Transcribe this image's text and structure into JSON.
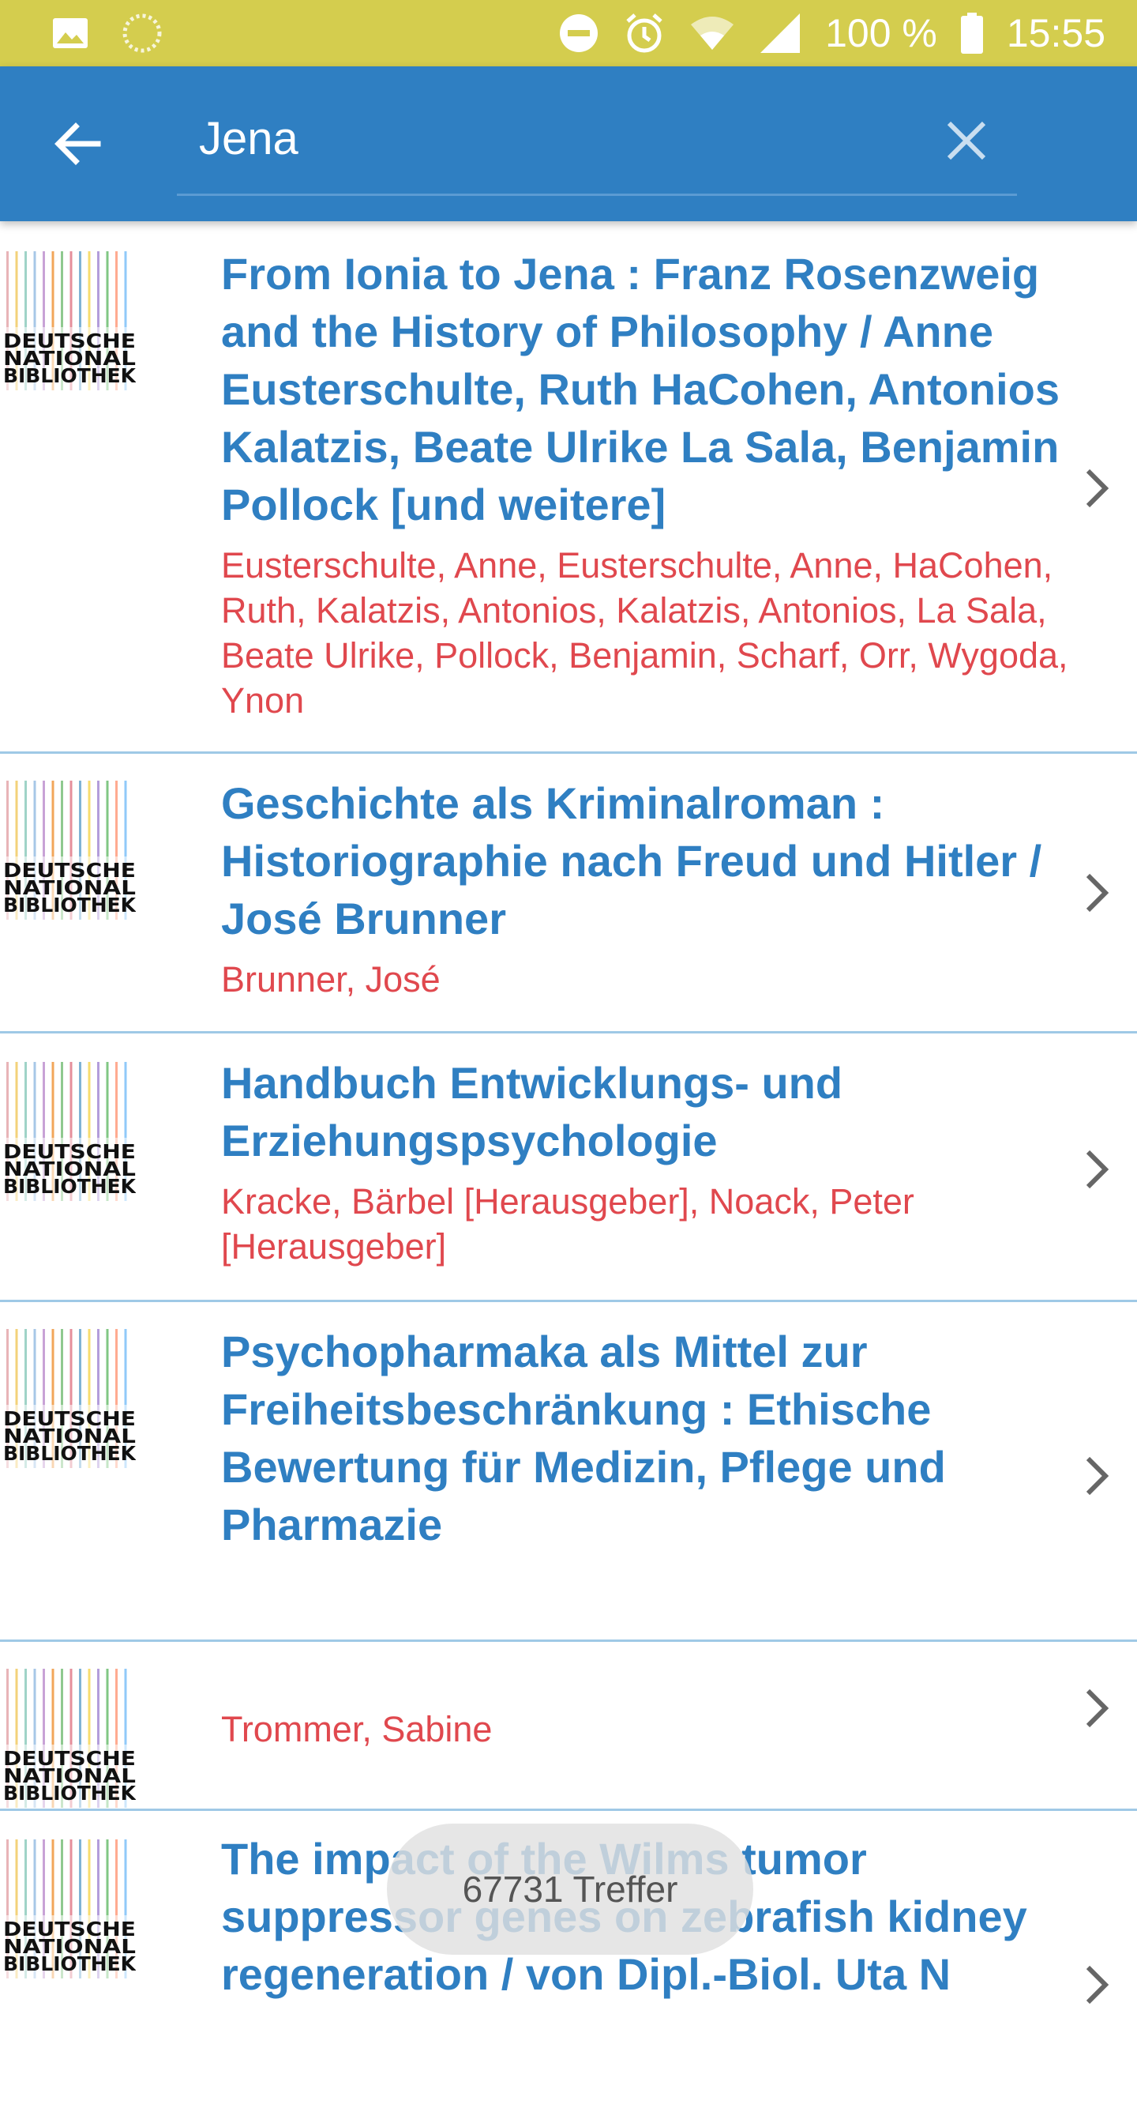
{
  "status_bar": {
    "battery": "100 %",
    "time": "15:55",
    "icons": [
      "image-icon",
      "loading-icon",
      "do-not-disturb-icon",
      "alarm-icon",
      "wifi-icon",
      "signal-icon",
      "battery-icon"
    ]
  },
  "app_bar": {
    "back_icon": "arrow-left-icon",
    "search_value": "Jena",
    "clear_icon": "close-icon"
  },
  "results": [
    {
      "thumbnail_alt": "DEUTSCHE NATIONAL BIBLIOTHEK",
      "title": "From Ionia to Jena : Franz Rosenzweig and the History of Philosophy / Anne Eusterschulte, Ruth HaCohen, Antonios Kalatzis, Beate Ulrike La Sala, Benjamin Pollock [und weitere]",
      "authors": "Eusterschulte, Anne, Eusterschulte, Anne, HaCohen, Ruth, Kalatzis, Antonios, Kalatzis, Antonios, La Sala, Beate Ulrike, Pollock, Benjamin, Scharf, Orr, Wygoda, Ynon"
    },
    {
      "thumbnail_alt": "DEUTSCHE NATIONAL BIBLIOTHEK",
      "title": "Geschichte als Kriminalroman : Historiographie nach Freud und Hitler / José Brunner",
      "authors": "Brunner, José"
    },
    {
      "thumbnail_alt": "DEUTSCHE NATIONAL BIBLIOTHEK",
      "title": "Handbuch Entwicklungs- und Erziehungspsychologie",
      "authors": "Kracke, Bärbel [Herausgeber], Noack, Peter [Herausgeber]"
    },
    {
      "thumbnail_alt": "DEUTSCHE NATIONAL BIBLIOTHEK",
      "title": "Psychopharmaka als Mittel zur Freiheitsbeschränkung : Ethische Bewertung für Medizin, Pflege und Pharmazie",
      "authors": ""
    },
    {
      "thumbnail_alt": "DEUTSCHE NATIONAL BIBLIOTHEK",
      "title": "",
      "authors": "Trommer, Sabine"
    },
    {
      "thumbnail_alt": "DEUTSCHE NATIONAL BIBLIOTHEK",
      "title": "The impact of the Wilms tumor suppressor genes on zebrafish kidney regeneration / von Dipl.-Biol. Uta N",
      "authors": ""
    }
  ],
  "toast": {
    "text": "67731 Treffer"
  },
  "colors": {
    "status_bar": "#d4cd4e",
    "app_bar": "#2f7fc2",
    "title": "#2f7fc2",
    "authors": "#e0484e",
    "divider": "#9fc9e6"
  }
}
